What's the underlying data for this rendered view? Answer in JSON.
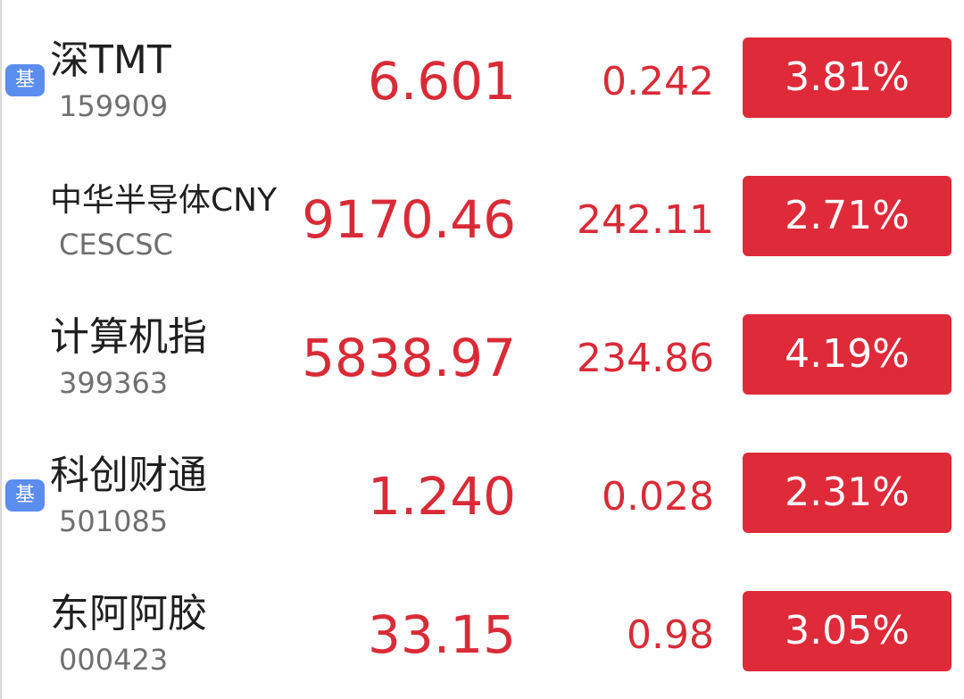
{
  "colors": {
    "up_red": "#d92b37",
    "badge_bg": "#de2a39",
    "fund_badge_bg": "#5b8def",
    "name_text": "#1f1f1f",
    "code_text": "#6f6f6f"
  },
  "rows": [
    {
      "badge": "基",
      "name": "深TMT",
      "code": "159909",
      "price": "6.601",
      "change": "0.242",
      "pct": "3.81%"
    },
    {
      "badge": "",
      "name": "中华半导体CNY",
      "code": "CESCSC",
      "price": "9170.46",
      "change": "242.11",
      "pct": "2.71%"
    },
    {
      "badge": "",
      "name": "计算机指",
      "code": "399363",
      "price": "5838.97",
      "change": "234.86",
      "pct": "4.19%"
    },
    {
      "badge": "基",
      "name": "科创财通",
      "code": "501085",
      "price": "1.240",
      "change": "0.028",
      "pct": "2.31%"
    },
    {
      "badge": "",
      "name": "东阿阿胶",
      "code": "000423",
      "price": "33.15",
      "change": "0.98",
      "pct": "3.05%"
    }
  ]
}
